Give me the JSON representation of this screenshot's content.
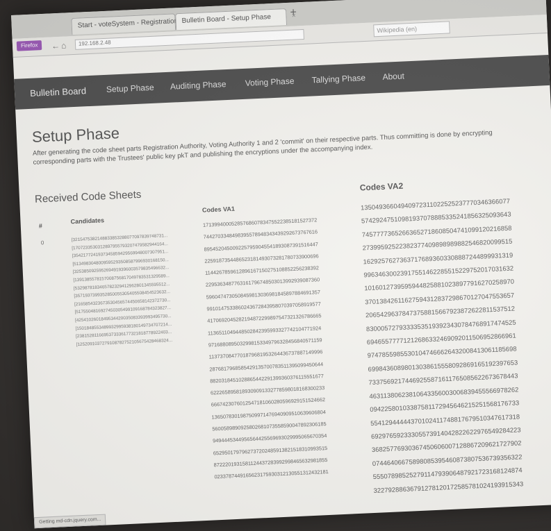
{
  "browser": {
    "app_menu": "Firefox",
    "tabs": [
      {
        "label": "Start - voteSystem - Registration Server"
      },
      {
        "label": "Bulletin Board - Setup Phase"
      }
    ],
    "url": "192.168.2.48",
    "search_placeholder": "Wikipedia (en)",
    "status": "Getting md-cdn.jquery.com..."
  },
  "nav": {
    "brand": "Bulletin Board",
    "items": [
      "Setup Phase",
      "Auditing Phase",
      "Voting Phase",
      "Tallying Phase",
      "About"
    ]
  },
  "page": {
    "title": "Setup Phase",
    "description": "After generating the code sheet parts Registration Authority, Voting Authority 1 and 2 'commit' on their respective parts. Thus committing is done by encrypting corresponding parts with the Trustees' public key pkT and publishing the encryptions under the accompanying index.",
    "section_title": "Received Code Sheets"
  },
  "table": {
    "headers": {
      "index": "#",
      "candidates": "Candidates",
      "va1": "Codes VA1",
      "va2": "Codes VA2"
    },
    "rows": [
      {
        "index": "0"
      }
    ],
    "candidates": [
      "[3215475382148833853288077097839748731...",
      "[1707233530312897955793207479582944164...",
      "[3542177241937345859429569948007307951...",
      "[5134983048009595293508587996930168150...",
      "[3253850925952694919396003579835496632...",
      "[1391385578157008756817049783531329589...",
      "[5329878183465782329412962801345595512...",
      "[3571937399352850055305405508454523632...",
      "[2165854323673530456574450658142372730...",
      "[5175504816927450305499109168784323827...",
      "[4254102601849534420035083393993495730...",
      "[1501848553489932995938180149734707214...",
      "[2381528116695373336177321818778922403...",
      "[1252091037279108782752105675428468324..."
    ],
    "va1": [
      "1713994000528576860783475522385181527372",
      "7442703348498395578948343439292673767616",
      "8954520450092257959045541893087391516447",
      "2259187354486523181493073281780733900696",
      "1144267859612896167150275108852256238392",
      "2295363487763161796748503013992939087360",
      "5960474730508459813036981845897884691357",
      "9910147533860243672843958070397058919577",
      "4170692045282194872299897547321326786665",
      "1136511049448502842395993327742104771924",
      "9716880895032998153349796328456840571159",
      "1137370847701879681953264436737887149996",
      "2876817968585429135700783511395099450644",
      "8820318451028865442291399360376115551677",
      "6222658958189309091332778598018168300233",
      "6667423076012547181060280596929151524662",
      "1365078301987509971476940909510639606804",
      "5600589890925802681073558590047892306185",
      "9494445344956564425569693029995065670354",
      "6529501797962737202485913821518310993515",
      "8722201931581124437283992998465632981855",
      "0233787449165623175930312130551312432181"
    ],
    "va2": [
      "13504936604940972311022525237770346366077",
      "57429247510981937078885335241856325093643",
      "74577773652663652718608504741099120216858",
      "27399592522382377409898989882546820099515",
      "16292576273637176893603308887244899931319",
      "99634630023917551462285515229752017031632",
      "10160127395959448258810238977916270258970",
      "37013842611627594312837298670127047553657",
      "20654296378473758815667923872622811537512",
      "83000572793333535193923430784768917474525",
      "69465577771212686332469092011506952866961",
      "97478559855301047466626432008413061185698",
      "69984360898013038615558092869165192397653",
      "73375692174469255871611765085622673678443",
      "46311380623810643356003006839455566978262",
      "09422580103387581172945646215251568176733",
      "55412944444370102411748817679510347617318",
      "69297659233305573914042822622976549284223",
      "36825776930367450606007128867209621727902",
      "07446406675898085395460873807536739356322",
      "55507898525279114793906487921723168124874",
      "32279288636791278120172585781024193915343"
    ]
  }
}
